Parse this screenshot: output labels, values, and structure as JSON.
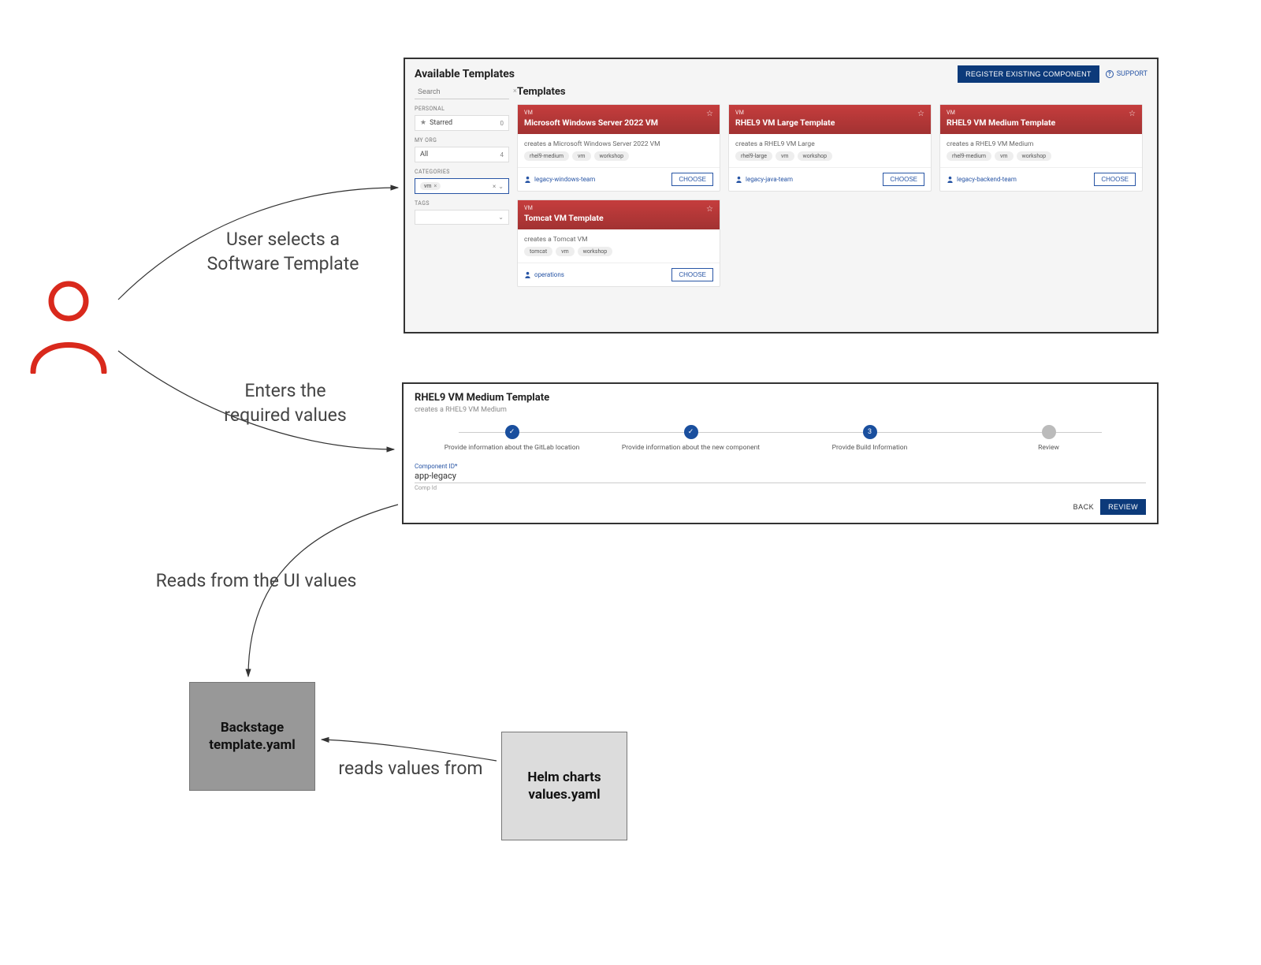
{
  "flow": {
    "label_select": "User selects a\nSoftware Template",
    "label_enter": "Enters the\nrequired values",
    "label_reads_ui": "Reads from the UI values",
    "label_reads_values": "reads values from"
  },
  "templates_panel": {
    "title": "Available Templates",
    "register_button": "REGISTER EXISTING COMPONENT",
    "support": "SUPPORT",
    "search_placeholder": "Search",
    "sidebar": {
      "section_personal": "PERSONAL",
      "starred_label": "Starred",
      "starred_count": "0",
      "section_myorg": "MY ORG",
      "all_label": "All",
      "all_count": "4",
      "section_categories": "CATEGORIES",
      "category_chip": "vm",
      "section_tags": "TAGS"
    },
    "main_title": "Templates",
    "cards": [
      {
        "category": "VM",
        "name": "Microsoft Windows Server 2022 VM",
        "description": "creates a Microsoft Windows Server 2022 VM",
        "tags": [
          "rhel9-medium",
          "vm",
          "workshop"
        ],
        "owner": "legacy-windows-team",
        "choose": "CHOOSE"
      },
      {
        "category": "VM",
        "name": "RHEL9 VM Large Template",
        "description": "creates a RHEL9 VM Large",
        "tags": [
          "rhel9-large",
          "vm",
          "workshop"
        ],
        "owner": "legacy-java-team",
        "choose": "CHOOSE"
      },
      {
        "category": "VM",
        "name": "RHEL9 VM Medium Template",
        "description": "creates a RHEL9 VM Medium",
        "tags": [
          "rhel9-medium",
          "vm",
          "workshop"
        ],
        "owner": "legacy-backend-team",
        "choose": "CHOOSE"
      },
      {
        "category": "VM",
        "name": "Tomcat VM Template",
        "description": "creates a Tomcat VM",
        "tags": [
          "tomcat",
          "vm",
          "workshop"
        ],
        "owner": "operations",
        "choose": "CHOOSE"
      }
    ]
  },
  "form_panel": {
    "title": "RHEL9 VM Medium Template",
    "subtitle": "creates a RHEL9 VM Medium",
    "steps": [
      {
        "label": "Provide information about the GitLab location",
        "state": "done"
      },
      {
        "label": "Provide information about the new component",
        "state": "done"
      },
      {
        "label": "Provide Build Information",
        "state": "active",
        "num": "3"
      },
      {
        "label": "Review",
        "state": "pending"
      }
    ],
    "field_label": "Component ID*",
    "field_value": "app-legacy",
    "field_hint": "Comp Id",
    "back": "BACK",
    "review": "REVIEW"
  },
  "files": {
    "backstage": "Backstage\ntemplate.yaml",
    "helm": "Helm charts\nvalues.yaml"
  }
}
